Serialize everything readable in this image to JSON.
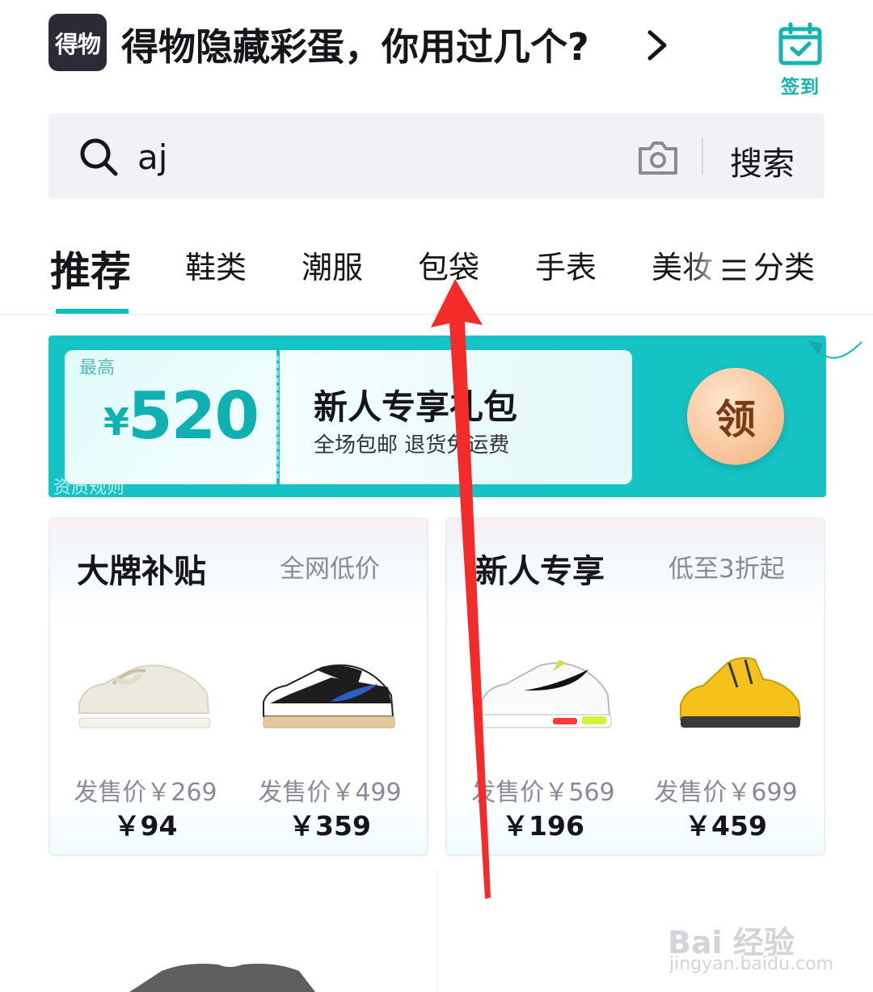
{
  "header": {
    "logo_text": "得物",
    "title": "得物隐藏彩蛋，你用过几个?",
    "checkin_label": "签到"
  },
  "search": {
    "query": "aj",
    "button_label": "搜索"
  },
  "tabs": [
    {
      "label": "推荐",
      "active": true
    },
    {
      "label": "鞋类",
      "active": false
    },
    {
      "label": "潮服",
      "active": false
    },
    {
      "label": "包袋",
      "active": false
    },
    {
      "label": "手表",
      "active": false
    },
    {
      "label": "美妆",
      "active": false
    }
  ],
  "category_button": {
    "icon": "menu-icon",
    "label": "分类"
  },
  "banner": {
    "max_label": "最高",
    "currency": "¥",
    "amount": "520",
    "title": "新人专享礼包",
    "subtitle": "全场包邮 退货免运费",
    "claim_label": "领",
    "rules_label": "资质规则"
  },
  "cards": [
    {
      "title": "大牌补贴",
      "subtitle": "全网低价",
      "products": [
        {
          "original": "发售价￥269",
          "price": "￥94"
        },
        {
          "original": "发售价￥499",
          "price": "￥359"
        }
      ]
    },
    {
      "title": "新人专享",
      "subtitle": "低至3折起",
      "products": [
        {
          "original": "发售价￥569",
          "price": "￥196"
        },
        {
          "original": "发售价￥699",
          "price": "￥459"
        }
      ]
    }
  ],
  "watermark": {
    "brand": "Bai 经验",
    "url": "jingyan.baidu.com"
  },
  "colors": {
    "accent": "#01c2c3",
    "banner": "#16c3c4",
    "annotation_arrow": "#f42b2b"
  }
}
